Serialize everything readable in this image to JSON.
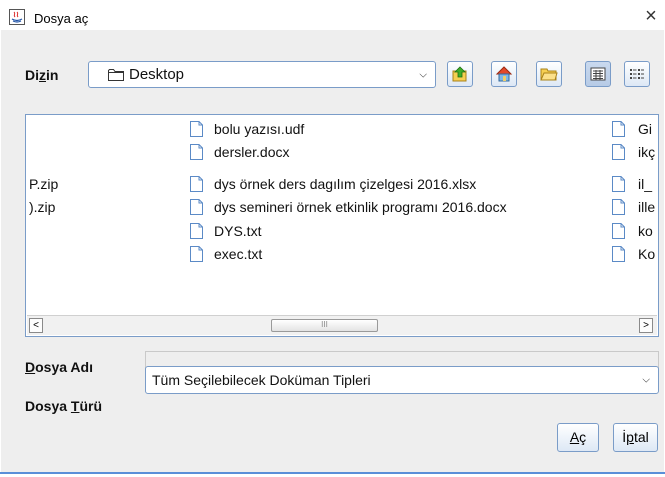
{
  "window": {
    "title": "Dosya aç",
    "close_glyph": "×"
  },
  "toolbar": {
    "dir_label_pre": "Di",
    "dir_label_u": "z",
    "dir_label_post": "in",
    "dir_value": "Desktop",
    "icons": [
      "up-folder-icon",
      "home-icon",
      "new-folder-icon",
      "list-view-icon",
      "details-view-icon"
    ]
  },
  "files": {
    "left_col": [
      {
        "name": "P.zip"
      },
      {
        "name": ").zip"
      }
    ],
    "middle_col": [
      {
        "name": "bolu yazısı.udf"
      },
      {
        "name": "dersler.docx"
      },
      {
        "name": "dys örnek ders dagılım çizelgesi 2016.xlsx"
      },
      {
        "name": "dys semineri örnek etkinlik programı 2016.docx"
      },
      {
        "name": "DYS.txt"
      },
      {
        "name": "exec.txt"
      }
    ],
    "right_col": [
      {
        "name": "Gi"
      },
      {
        "name": "ikç"
      },
      {
        "name": "il_"
      },
      {
        "name": "ille"
      },
      {
        "name": "ko"
      },
      {
        "name": "Ko"
      }
    ],
    "scrollbar": {
      "left_arrow": "<",
      "right_arrow": ">",
      "grip": "III"
    }
  },
  "form": {
    "filename_label_u": "D",
    "filename_label_rest": "osya Adı",
    "filename_value": "",
    "filetype_label_pre": "Dosya ",
    "filetype_label_u": "T",
    "filetype_label_post": "ürü",
    "filetype_value": "Tüm Seçilebilecek Doküman Tipleri"
  },
  "buttons": {
    "open_u": "A",
    "open_rest": "ç",
    "cancel_pre": "İ",
    "cancel_u": "p",
    "cancel_post": "tal"
  }
}
